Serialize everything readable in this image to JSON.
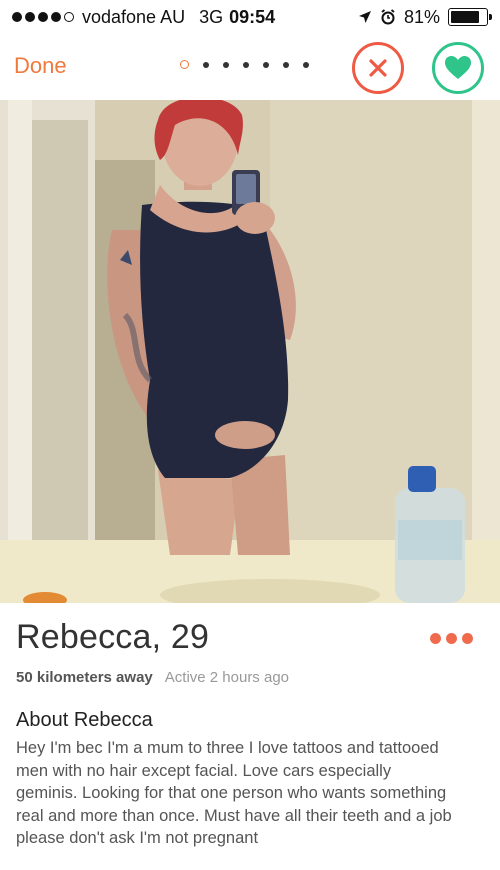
{
  "status_bar": {
    "carrier": "vodafone AU",
    "network": "3G",
    "time": "09:54",
    "battery": "81%",
    "battery_level": 0.81
  },
  "nav": {
    "done_label": "Done",
    "page_count": 7,
    "current_page": 1,
    "accent_color": "#f07a3d",
    "nope_color": "#ee5a44",
    "like_color": "#2fc48a"
  },
  "profile": {
    "name_age": "Rebecca, 29",
    "distance": "50 kilometers away",
    "active": "Active 2 hours ago",
    "about_title": "About Rebecca",
    "about_text": "Hey I'm bec I'm a mum to three I love tattoos and tattooed men with no hair except facial. Love cars especially geminis. Looking for that one person who wants something real and more than once. Must have all their teeth and a job please don't ask I'm not pregnant"
  }
}
